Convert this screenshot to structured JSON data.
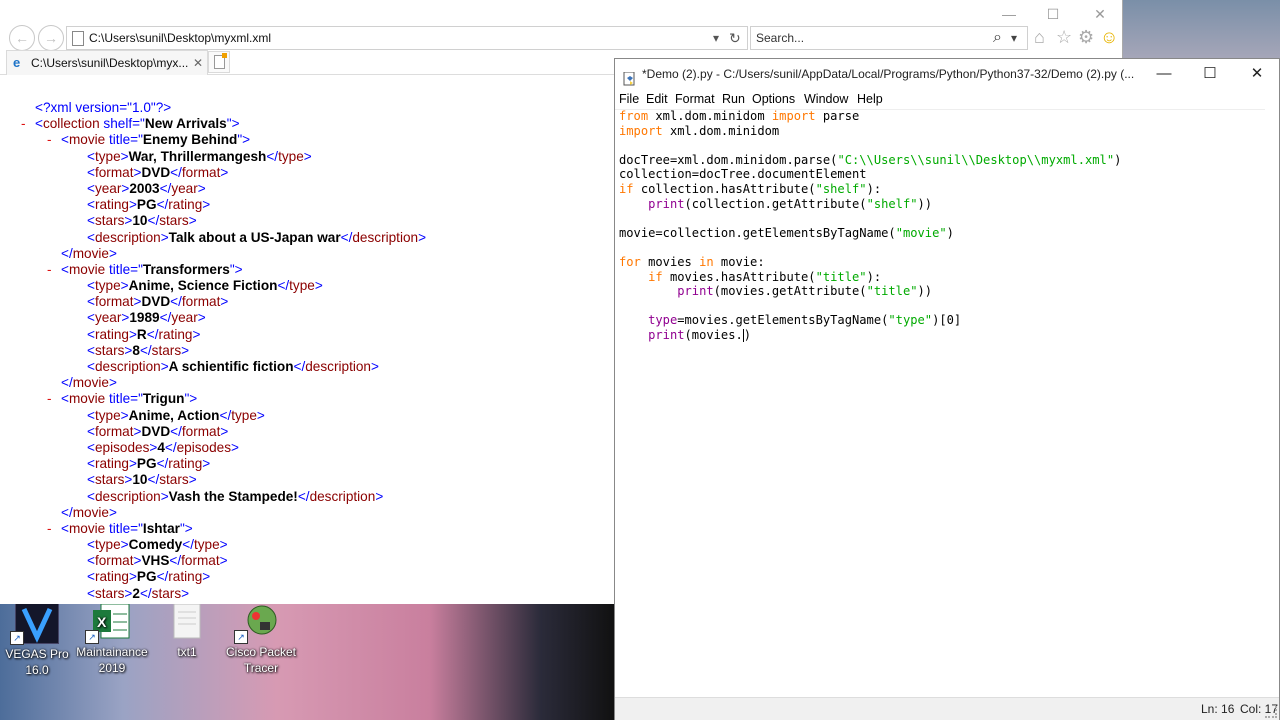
{
  "ie": {
    "address": "C:\\Users\\sunil\\Desktop\\myxml.xml",
    "search_placeholder": "Search...",
    "tab_label": "C:\\Users\\sunil\\Desktop\\myx...",
    "tab_close": "✕",
    "nav_back": "←",
    "nav_forward": "→",
    "address_dropdown": "▾",
    "refresh": "↻",
    "search_icon": "⌕",
    "search_dropdown": "▾",
    "home_icon": "⌂",
    "favorites_icon": "☆",
    "tools_icon": "⚙",
    "smiley_icon": "☺",
    "minimize": "—",
    "maximize": "☐",
    "close": "✕",
    "xml_rows": [
      {
        "indent": 1,
        "minus": "",
        "parts": [
          [
            "pi",
            "<?xml version=\"1.0\"?>"
          ]
        ]
      },
      {
        "indent": 1,
        "minus": "- ",
        "parts": [
          [
            "br",
            "<"
          ],
          [
            "tag",
            "collection"
          ],
          [
            "br",
            " shelf=\""
          ],
          [
            "av",
            "New Arrivals"
          ],
          [
            "br",
            "\">"
          ]
        ]
      },
      {
        "indent": 2,
        "minus": "- ",
        "parts": [
          [
            "br",
            "<"
          ],
          [
            "tag",
            "movie"
          ],
          [
            "br",
            " title=\""
          ],
          [
            "av",
            "Enemy Behind"
          ],
          [
            "br",
            "\">"
          ]
        ]
      },
      {
        "indent": 3,
        "minus": "",
        "parts": [
          [
            "br",
            "<"
          ],
          [
            "tag",
            "type"
          ],
          [
            "br",
            ">"
          ],
          [
            "tx",
            "War, Thrillermangesh"
          ],
          [
            "br",
            "</"
          ],
          [
            "tag",
            "type"
          ],
          [
            "br",
            ">"
          ]
        ]
      },
      {
        "indent": 3,
        "minus": "",
        "parts": [
          [
            "br",
            "<"
          ],
          [
            "tag",
            "format"
          ],
          [
            "br",
            ">"
          ],
          [
            "tx",
            "DVD"
          ],
          [
            "br",
            "</"
          ],
          [
            "tag",
            "format"
          ],
          [
            "br",
            ">"
          ]
        ]
      },
      {
        "indent": 3,
        "minus": "",
        "parts": [
          [
            "br",
            "<"
          ],
          [
            "tag",
            "year"
          ],
          [
            "br",
            ">"
          ],
          [
            "tx",
            "2003"
          ],
          [
            "br",
            "</"
          ],
          [
            "tag",
            "year"
          ],
          [
            "br",
            ">"
          ]
        ]
      },
      {
        "indent": 3,
        "minus": "",
        "parts": [
          [
            "br",
            "<"
          ],
          [
            "tag",
            "rating"
          ],
          [
            "br",
            ">"
          ],
          [
            "tx",
            "PG"
          ],
          [
            "br",
            "</"
          ],
          [
            "tag",
            "rating"
          ],
          [
            "br",
            ">"
          ]
        ]
      },
      {
        "indent": 3,
        "minus": "",
        "parts": [
          [
            "br",
            "<"
          ],
          [
            "tag",
            "stars"
          ],
          [
            "br",
            ">"
          ],
          [
            "tx",
            "10"
          ],
          [
            "br",
            "</"
          ],
          [
            "tag",
            "stars"
          ],
          [
            "br",
            ">"
          ]
        ]
      },
      {
        "indent": 3,
        "minus": "",
        "parts": [
          [
            "br",
            "<"
          ],
          [
            "tag",
            "description"
          ],
          [
            "br",
            ">"
          ],
          [
            "tx",
            "Talk about a US-Japan war"
          ],
          [
            "br",
            "</"
          ],
          [
            "tag",
            "description"
          ],
          [
            "br",
            ">"
          ]
        ]
      },
      {
        "indent": 2,
        "minus": "",
        "parts": [
          [
            "br",
            "</"
          ],
          [
            "tag",
            "movie"
          ],
          [
            "br",
            ">"
          ]
        ]
      },
      {
        "indent": 2,
        "minus": "- ",
        "parts": [
          [
            "br",
            "<"
          ],
          [
            "tag",
            "movie"
          ],
          [
            "br",
            " title=\""
          ],
          [
            "av",
            "Transformers"
          ],
          [
            "br",
            "\">"
          ]
        ]
      },
      {
        "indent": 3,
        "minus": "",
        "parts": [
          [
            "br",
            "<"
          ],
          [
            "tag",
            "type"
          ],
          [
            "br",
            ">"
          ],
          [
            "tx",
            "Anime, Science Fiction"
          ],
          [
            "br",
            "</"
          ],
          [
            "tag",
            "type"
          ],
          [
            "br",
            ">"
          ]
        ]
      },
      {
        "indent": 3,
        "minus": "",
        "parts": [
          [
            "br",
            "<"
          ],
          [
            "tag",
            "format"
          ],
          [
            "br",
            ">"
          ],
          [
            "tx",
            "DVD"
          ],
          [
            "br",
            "</"
          ],
          [
            "tag",
            "format"
          ],
          [
            "br",
            ">"
          ]
        ]
      },
      {
        "indent": 3,
        "minus": "",
        "parts": [
          [
            "br",
            "<"
          ],
          [
            "tag",
            "year"
          ],
          [
            "br",
            ">"
          ],
          [
            "tx",
            "1989"
          ],
          [
            "br",
            "</"
          ],
          [
            "tag",
            "year"
          ],
          [
            "br",
            ">"
          ]
        ]
      },
      {
        "indent": 3,
        "minus": "",
        "parts": [
          [
            "br",
            "<"
          ],
          [
            "tag",
            "rating"
          ],
          [
            "br",
            ">"
          ],
          [
            "tx",
            "R"
          ],
          [
            "br",
            "</"
          ],
          [
            "tag",
            "rating"
          ],
          [
            "br",
            ">"
          ]
        ]
      },
      {
        "indent": 3,
        "minus": "",
        "parts": [
          [
            "br",
            "<"
          ],
          [
            "tag",
            "stars"
          ],
          [
            "br",
            ">"
          ],
          [
            "tx",
            "8"
          ],
          [
            "br",
            "</"
          ],
          [
            "tag",
            "stars"
          ],
          [
            "br",
            ">"
          ]
        ]
      },
      {
        "indent": 3,
        "minus": "",
        "parts": [
          [
            "br",
            "<"
          ],
          [
            "tag",
            "description"
          ],
          [
            "br",
            ">"
          ],
          [
            "tx",
            "A schientific fiction"
          ],
          [
            "br",
            "</"
          ],
          [
            "tag",
            "description"
          ],
          [
            "br",
            ">"
          ]
        ]
      },
      {
        "indent": 2,
        "minus": "",
        "parts": [
          [
            "br",
            "</"
          ],
          [
            "tag",
            "movie"
          ],
          [
            "br",
            ">"
          ]
        ]
      },
      {
        "indent": 2,
        "minus": "- ",
        "parts": [
          [
            "br",
            "<"
          ],
          [
            "tag",
            "movie"
          ],
          [
            "br",
            " title=\""
          ],
          [
            "av",
            "Trigun"
          ],
          [
            "br",
            "\">"
          ]
        ]
      },
      {
        "indent": 3,
        "minus": "",
        "parts": [
          [
            "br",
            "<"
          ],
          [
            "tag",
            "type"
          ],
          [
            "br",
            ">"
          ],
          [
            "tx",
            "Anime, Action"
          ],
          [
            "br",
            "</"
          ],
          [
            "tag",
            "type"
          ],
          [
            "br",
            ">"
          ]
        ]
      },
      {
        "indent": 3,
        "minus": "",
        "parts": [
          [
            "br",
            "<"
          ],
          [
            "tag",
            "format"
          ],
          [
            "br",
            ">"
          ],
          [
            "tx",
            "DVD"
          ],
          [
            "br",
            "</"
          ],
          [
            "tag",
            "format"
          ],
          [
            "br",
            ">"
          ]
        ]
      },
      {
        "indent": 3,
        "minus": "",
        "parts": [
          [
            "br",
            "<"
          ],
          [
            "tag",
            "episodes"
          ],
          [
            "br",
            ">"
          ],
          [
            "tx",
            "4"
          ],
          [
            "br",
            "</"
          ],
          [
            "tag",
            "episodes"
          ],
          [
            "br",
            ">"
          ]
        ]
      },
      {
        "indent": 3,
        "minus": "",
        "parts": [
          [
            "br",
            "<"
          ],
          [
            "tag",
            "rating"
          ],
          [
            "br",
            ">"
          ],
          [
            "tx",
            "PG"
          ],
          [
            "br",
            "</"
          ],
          [
            "tag",
            "rating"
          ],
          [
            "br",
            ">"
          ]
        ]
      },
      {
        "indent": 3,
        "minus": "",
        "parts": [
          [
            "br",
            "<"
          ],
          [
            "tag",
            "stars"
          ],
          [
            "br",
            ">"
          ],
          [
            "tx",
            "10"
          ],
          [
            "br",
            "</"
          ],
          [
            "tag",
            "stars"
          ],
          [
            "br",
            ">"
          ]
        ]
      },
      {
        "indent": 3,
        "minus": "",
        "parts": [
          [
            "br",
            "<"
          ],
          [
            "tag",
            "description"
          ],
          [
            "br",
            ">"
          ],
          [
            "tx",
            "Vash the Stampede!"
          ],
          [
            "br",
            "</"
          ],
          [
            "tag",
            "description"
          ],
          [
            "br",
            ">"
          ]
        ]
      },
      {
        "indent": 2,
        "minus": "",
        "parts": [
          [
            "br",
            "</"
          ],
          [
            "tag",
            "movie"
          ],
          [
            "br",
            ">"
          ]
        ]
      },
      {
        "indent": 2,
        "minus": "- ",
        "parts": [
          [
            "br",
            "<"
          ],
          [
            "tag",
            "movie"
          ],
          [
            "br",
            " title=\""
          ],
          [
            "av",
            "Ishtar"
          ],
          [
            "br",
            "\">"
          ]
        ]
      },
      {
        "indent": 3,
        "minus": "",
        "parts": [
          [
            "br",
            "<"
          ],
          [
            "tag",
            "type"
          ],
          [
            "br",
            ">"
          ],
          [
            "tx",
            "Comedy"
          ],
          [
            "br",
            "</"
          ],
          [
            "tag",
            "type"
          ],
          [
            "br",
            ">"
          ]
        ]
      },
      {
        "indent": 3,
        "minus": "",
        "parts": [
          [
            "br",
            "<"
          ],
          [
            "tag",
            "format"
          ],
          [
            "br",
            ">"
          ],
          [
            "tx",
            "VHS"
          ],
          [
            "br",
            "</"
          ],
          [
            "tag",
            "format"
          ],
          [
            "br",
            ">"
          ]
        ]
      },
      {
        "indent": 3,
        "minus": "",
        "parts": [
          [
            "br",
            "<"
          ],
          [
            "tag",
            "rating"
          ],
          [
            "br",
            ">"
          ],
          [
            "tx",
            "PG"
          ],
          [
            "br",
            "</"
          ],
          [
            "tag",
            "rating"
          ],
          [
            "br",
            ">"
          ]
        ]
      },
      {
        "indent": 3,
        "minus": "",
        "parts": [
          [
            "br",
            "<"
          ],
          [
            "tag",
            "stars"
          ],
          [
            "br",
            ">"
          ],
          [
            "tx",
            "2"
          ],
          [
            "br",
            "</"
          ],
          [
            "tag",
            "stars"
          ],
          [
            "br",
            ">"
          ]
        ]
      }
    ]
  },
  "idle": {
    "title": "*Demo (2).py - C:/Users/sunil/AppData/Local/Programs/Python/Python37-32/Demo (2).py (...",
    "minimize": "—",
    "maximize": "☐",
    "close": "✕",
    "menu": [
      "File",
      "Edit",
      "Format",
      "Run",
      "Options",
      "Window",
      "Help"
    ],
    "code_lines": [
      [
        [
          "kw",
          "from"
        ],
        [
          "n",
          " xml.dom.minidom "
        ],
        [
          "kw",
          "import"
        ],
        [
          "n",
          " parse"
        ]
      ],
      [
        [
          "kw",
          "import"
        ],
        [
          "n",
          " xml.dom.minidom"
        ]
      ],
      [],
      [
        [
          "n",
          "docTree=xml.dom.minidom.parse("
        ],
        [
          "st",
          "\"C:\\\\Users\\\\sunil\\\\Desktop\\\\myxml.xml\""
        ],
        [
          "n",
          ")"
        ]
      ],
      [
        [
          "n",
          "collection=docTree.documentElement"
        ]
      ],
      [
        [
          "kw",
          "if"
        ],
        [
          "n",
          " collection.hasAttribute("
        ],
        [
          "st",
          "\"shelf\""
        ],
        [
          "n",
          "):"
        ]
      ],
      [
        [
          "n",
          "    "
        ],
        [
          "bi",
          "print"
        ],
        [
          "n",
          "(collection.getAttribute("
        ],
        [
          "st",
          "\"shelf\""
        ],
        [
          "n",
          "))"
        ]
      ],
      [],
      [
        [
          "n",
          "movie=collection.getElementsByTagName("
        ],
        [
          "st",
          "\"movie\""
        ],
        [
          "n",
          ")"
        ]
      ],
      [],
      [
        [
          "kw",
          "for"
        ],
        [
          "n",
          " movies "
        ],
        [
          "kw",
          "in"
        ],
        [
          "n",
          " movie:"
        ]
      ],
      [
        [
          "n",
          "    "
        ],
        [
          "kw",
          "if"
        ],
        [
          "n",
          " movies.hasAttribute("
        ],
        [
          "st",
          "\"title\""
        ],
        [
          "n",
          "):"
        ]
      ],
      [
        [
          "n",
          "        "
        ],
        [
          "bi",
          "print"
        ],
        [
          "n",
          "(movies.getAttribute("
        ],
        [
          "st",
          "\"title\""
        ],
        [
          "n",
          "))"
        ]
      ],
      [],
      [
        [
          "n",
          "    "
        ],
        [
          "bi",
          "type"
        ],
        [
          "n",
          "=movies.getElementsByTagName("
        ],
        [
          "st",
          "\"type\""
        ],
        [
          "n",
          ")[0]"
        ]
      ],
      [
        [
          "n",
          "    "
        ],
        [
          "bi",
          "print"
        ],
        [
          "n",
          "(movies."
        ],
        [
          "caret",
          ""
        ],
        [
          "n",
          ")"
        ]
      ]
    ],
    "status_ln": "Ln: 16",
    "status_col": "Col: 17"
  },
  "desktop_icons": [
    {
      "label": "VEGAS Pro\n16.0",
      "color": "#1a1a2e"
    },
    {
      "label": "Maintainance\n2019",
      "color": "#1d7a3c"
    },
    {
      "label": "txt1",
      "color": "#f2f2f2"
    },
    {
      "label": "Cisco Packet\nTracer",
      "color": "#6aa84f"
    }
  ]
}
